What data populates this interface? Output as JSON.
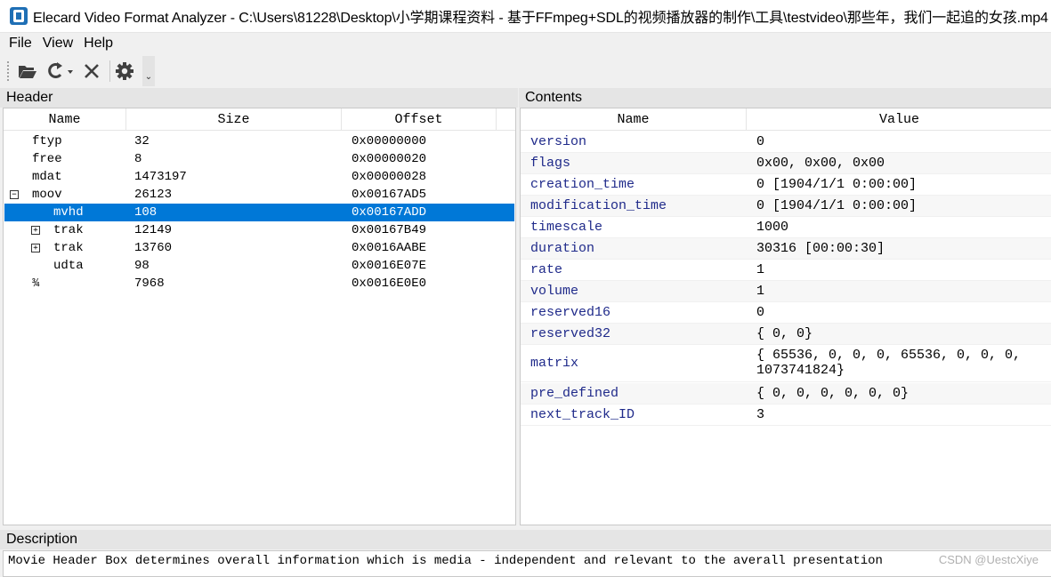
{
  "window": {
    "title": "Elecard Video Format Analyzer - C:\\Users\\81228\\Desktop\\小学期课程资料 - 基于FFmpeg+SDL的视频播放器的制作\\工具\\testvideo\\那些年，我们一起追的女孩.mp4",
    "icon": "app-icon"
  },
  "menu": {
    "items": [
      "File",
      "View",
      "Help"
    ]
  },
  "toolbar": {
    "buttons": [
      "open-folder-icon",
      "refresh-icon",
      "close-icon",
      "settings-gear-icon"
    ],
    "overflow_glyph": "⌄"
  },
  "header_panel": {
    "title": "Header",
    "columns": [
      "Name",
      "Size",
      "Offset"
    ],
    "rows": [
      {
        "name": "ftyp",
        "size": "32",
        "offset": "0x00000000",
        "level": 0,
        "expander": "",
        "selected": false
      },
      {
        "name": "free",
        "size": "8",
        "offset": "0x00000020",
        "level": 0,
        "expander": "",
        "selected": false
      },
      {
        "name": "mdat",
        "size": "1473197",
        "offset": "0x00000028",
        "level": 0,
        "expander": "",
        "selected": false
      },
      {
        "name": "moov",
        "size": "26123",
        "offset": "0x00167AD5",
        "level": 0,
        "expander": "−",
        "selected": false
      },
      {
        "name": "mvhd",
        "size": "108",
        "offset": "0x00167ADD",
        "level": 1,
        "expander": "",
        "selected": true
      },
      {
        "name": "trak",
        "size": "12149",
        "offset": "0x00167B49",
        "level": 1,
        "expander": "+",
        "selected": false
      },
      {
        "name": "trak",
        "size": "13760",
        "offset": "0x0016AABE",
        "level": 1,
        "expander": "+",
        "selected": false
      },
      {
        "name": "udta",
        "size": "98",
        "offset": "0x0016E07E",
        "level": 1,
        "expander": "",
        "selected": false
      },
      {
        "name": "¾",
        "size": "7968",
        "offset": "0x0016E0E0",
        "level": 0,
        "expander": "",
        "selected": false
      }
    ]
  },
  "contents_panel": {
    "title": "Contents",
    "columns": [
      "Name",
      "Value"
    ],
    "rows": [
      {
        "name": "version",
        "value": "0"
      },
      {
        "name": "flags",
        "value": "0x00, 0x00, 0x00"
      },
      {
        "name": "creation_time",
        "value": "0 [1904/1/1 0:00:00]"
      },
      {
        "name": "modification_time",
        "value": "0 [1904/1/1 0:00:00]"
      },
      {
        "name": "timescale",
        "value": "1000"
      },
      {
        "name": "duration",
        "value": "30316 [00:00:30]"
      },
      {
        "name": "rate",
        "value": "1"
      },
      {
        "name": "volume",
        "value": "1"
      },
      {
        "name": "reserved16",
        "value": "0"
      },
      {
        "name": "reserved32",
        "value": "{ 0, 0}"
      },
      {
        "name": "matrix",
        "value": "{ 65536, 0, 0, 0, 65536, 0, 0, 0,",
        "value_line2": "1073741824}"
      },
      {
        "name": "pre_defined",
        "value": "{ 0, 0, 0, 0, 0, 0}"
      },
      {
        "name": "next_track_ID",
        "value": "3"
      }
    ]
  },
  "description_panel": {
    "title": "Description",
    "text": "Movie Header Box  determines overall information which is media - independent and relevant to the averall presentation"
  },
  "watermark": "CSDN @UestcXiye",
  "colors": {
    "selection": "#0078d7",
    "field_name": "#1f2a8a",
    "panel_background": "#f0f0f0"
  }
}
